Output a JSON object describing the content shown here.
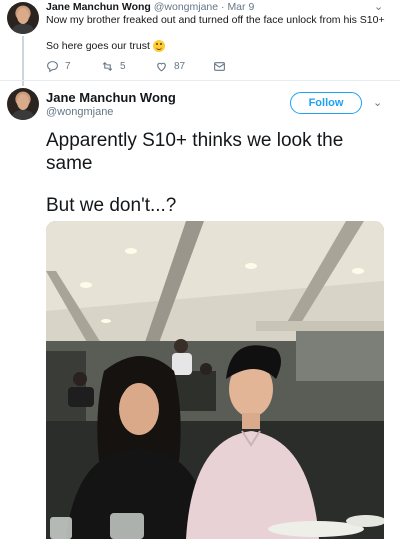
{
  "reply_tweet": {
    "author_name": "Jane Manchun Wong",
    "author_handle": "@wongmjane",
    "separator": "·",
    "date": "Mar 9",
    "text_line1": "Now my brother freaked out and turned off the face unlock from his S10+",
    "text_line2": "So here goes our trust",
    "emoji": "slightly-smiling-face",
    "actions": {
      "replies": "7",
      "retweets": "5",
      "likes": "87"
    }
  },
  "main_tweet": {
    "author_name": "Jane Manchun Wong",
    "author_handle": "@wongmjane",
    "follow_label": "Follow",
    "text_line1": "Apparently S10+ thinks we look the",
    "text_line2": "same",
    "text_line3": "But we don't...?"
  },
  "colors": {
    "accent": "#1da1f2",
    "muted": "#657786",
    "text": "#14171a"
  }
}
